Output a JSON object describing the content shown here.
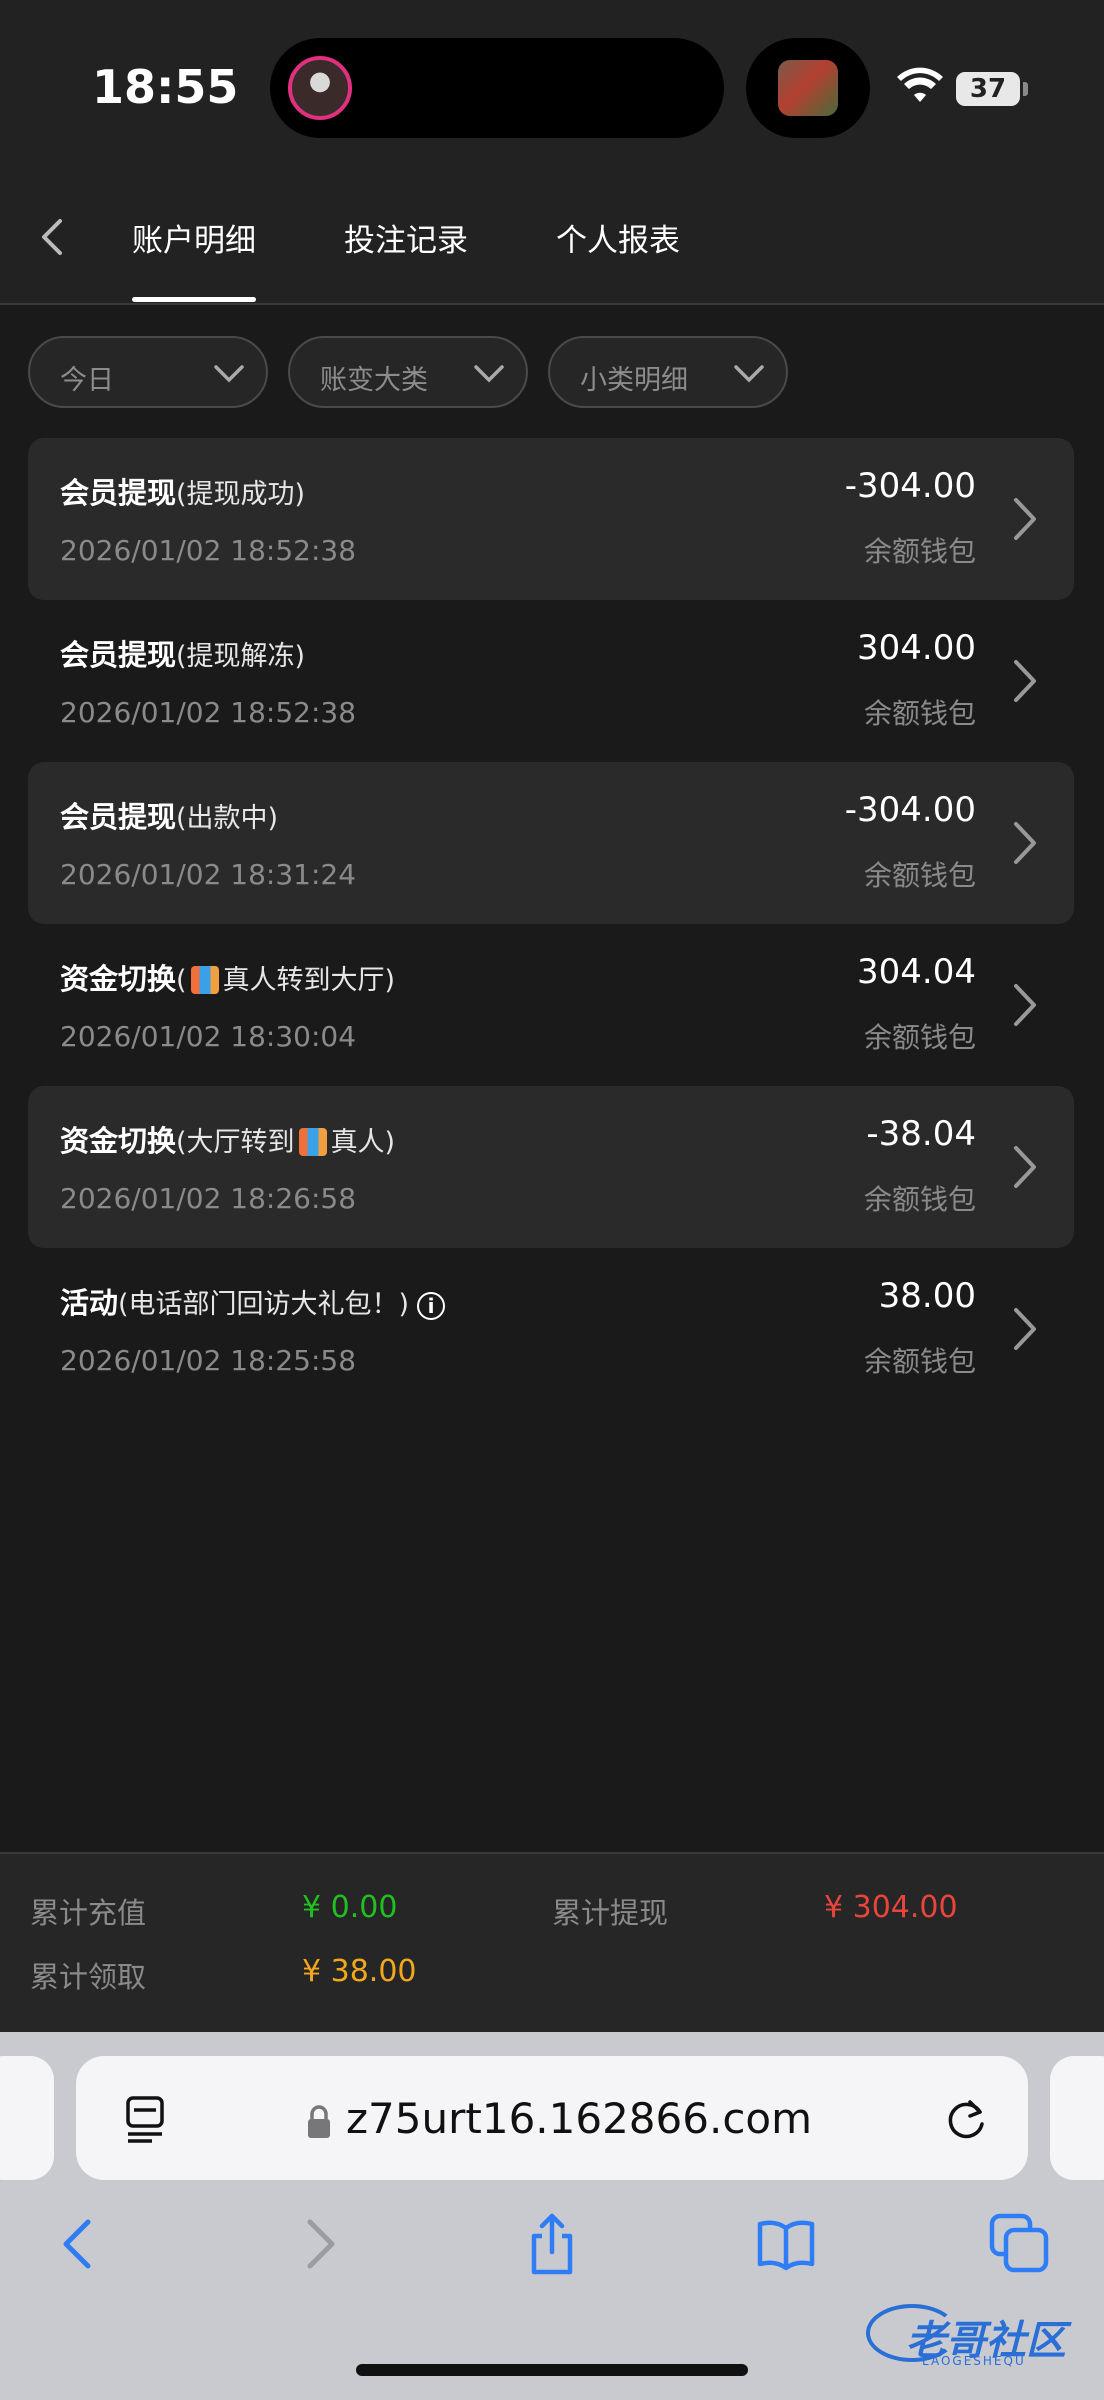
{
  "status": {
    "time": "18:55",
    "battery": "37"
  },
  "nav": {
    "tabs": [
      {
        "label": "账户明细"
      },
      {
        "label": "投注记录"
      },
      {
        "label": "个人报表"
      }
    ]
  },
  "filters": [
    {
      "label": "今日"
    },
    {
      "label": "账变大类"
    },
    {
      "label": "小类明细"
    }
  ],
  "records": [
    {
      "type": "会员提现",
      "pre": "(提现成功)",
      "post": "",
      "time": "2026/01/02 18:52:38",
      "amount": "-304.00",
      "wallet": "余额钱包"
    },
    {
      "type": "会员提现",
      "pre": "(提现解冻)",
      "post": "",
      "time": "2026/01/02 18:52:38",
      "amount": "304.00",
      "wallet": "余额钱包"
    },
    {
      "type": "会员提现",
      "pre": "(出款中)",
      "post": "",
      "time": "2026/01/02 18:31:24",
      "amount": "-304.00",
      "wallet": "余额钱包"
    },
    {
      "type": "资金切换",
      "pre": "(",
      "post": "真人转到大厅)",
      "time": "2026/01/02 18:30:04",
      "amount": "304.04",
      "wallet": "余额钱包"
    },
    {
      "type": "资金切换",
      "pre": "(大厅转到",
      "post": "真人)",
      "time": "2026/01/02 18:26:58",
      "amount": "-38.04",
      "wallet": "余额钱包"
    },
    {
      "type": "活动",
      "pre": "(电话部门回访大礼包！)",
      "post": "",
      "time": "2026/01/02 18:25:58",
      "amount": "38.00",
      "wallet": "余额钱包"
    }
  ],
  "summary": {
    "recharge_label": "累计充值",
    "recharge_value": "¥ 0.00",
    "withdraw_label": "累计提现",
    "withdraw_value": "¥ 304.00",
    "claim_label": "累计领取",
    "claim_value": "¥ 38.00",
    "colors": {
      "recharge": "#1fc11f",
      "withdraw": "#e8453c",
      "claim": "#f2a81c"
    }
  },
  "browser": {
    "url": "z75urt16.162866.com"
  },
  "watermark": {
    "text": "老哥社区",
    "subtext": "LAOGESHEQU"
  }
}
